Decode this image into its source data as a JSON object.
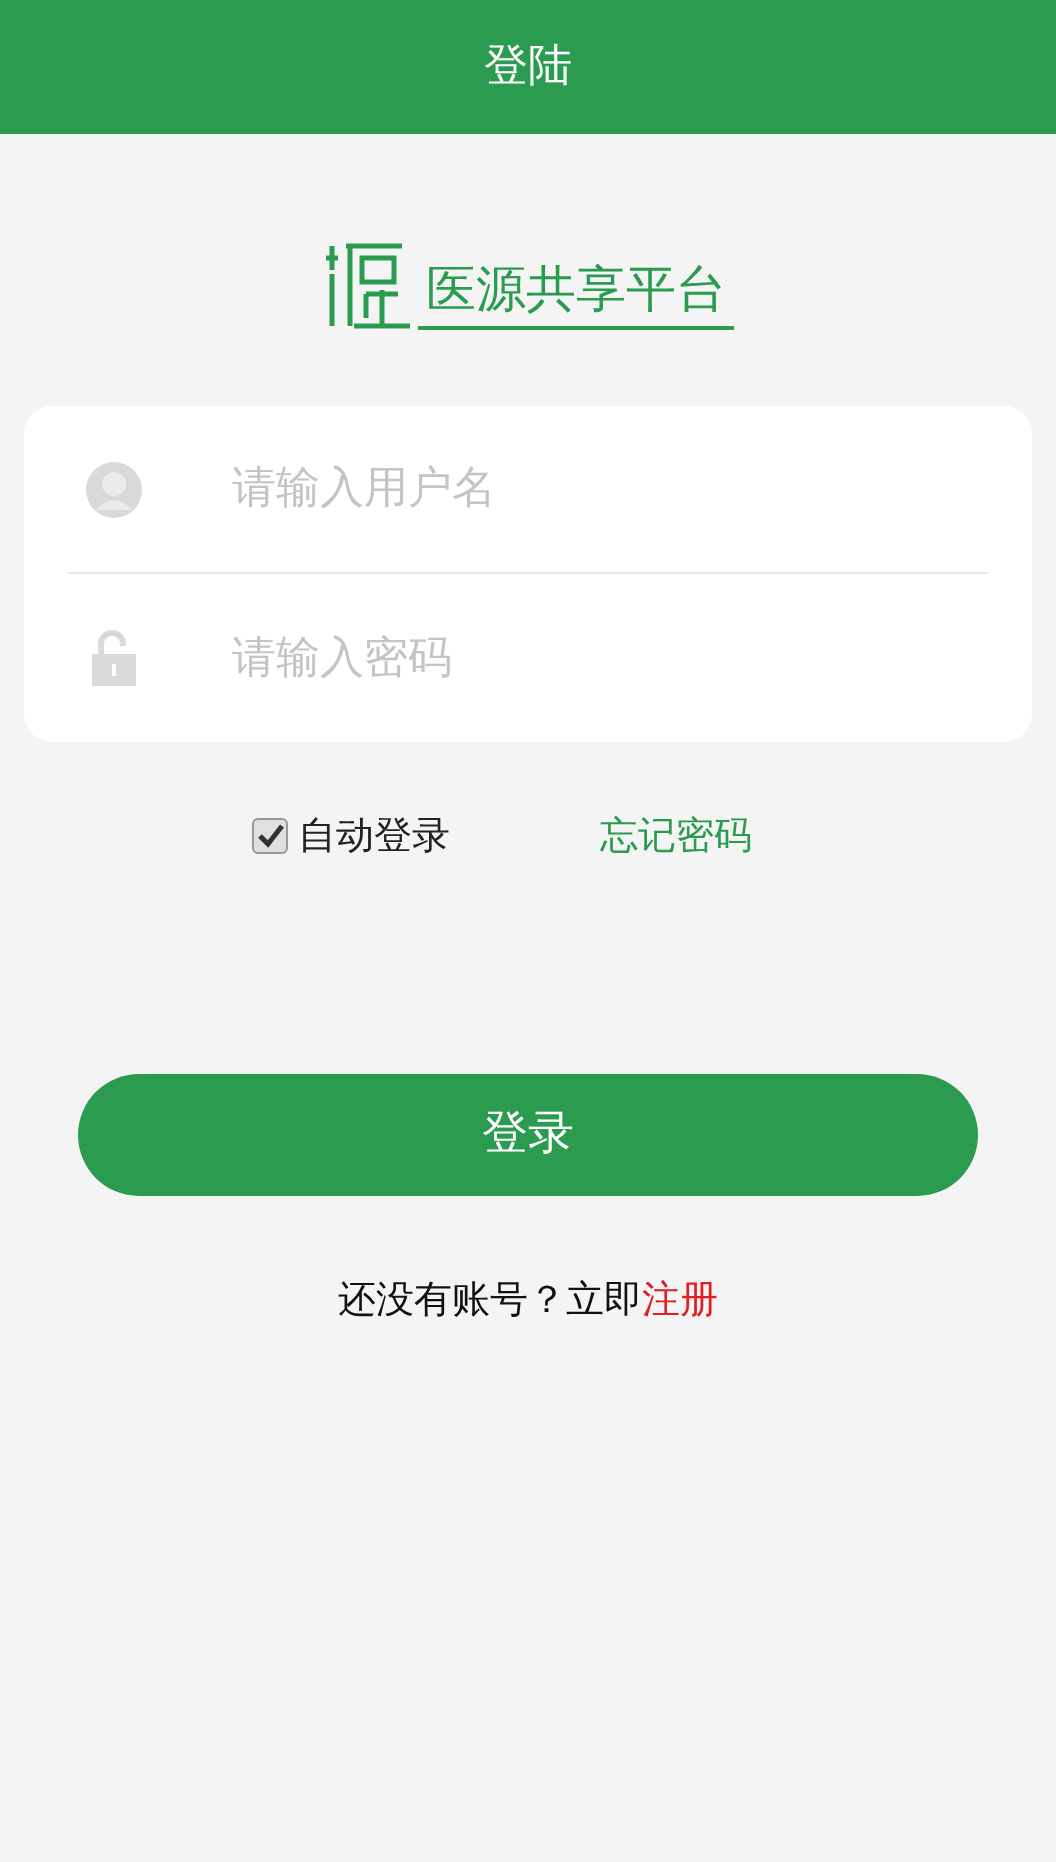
{
  "header": {
    "title": "登陆"
  },
  "logo": {
    "text": "医源共享平台"
  },
  "fields": [
    {
      "kind": "user",
      "placeholder": "请输入用户名"
    },
    {
      "kind": "lock",
      "placeholder": "请输入密码"
    }
  ],
  "auto_login": {
    "label": "自动登录",
    "checked": true
  },
  "forgot_link": "忘记密码",
  "login_button": "登录",
  "register": {
    "prompt": "还没有账号？立即",
    "link": "注册"
  }
}
